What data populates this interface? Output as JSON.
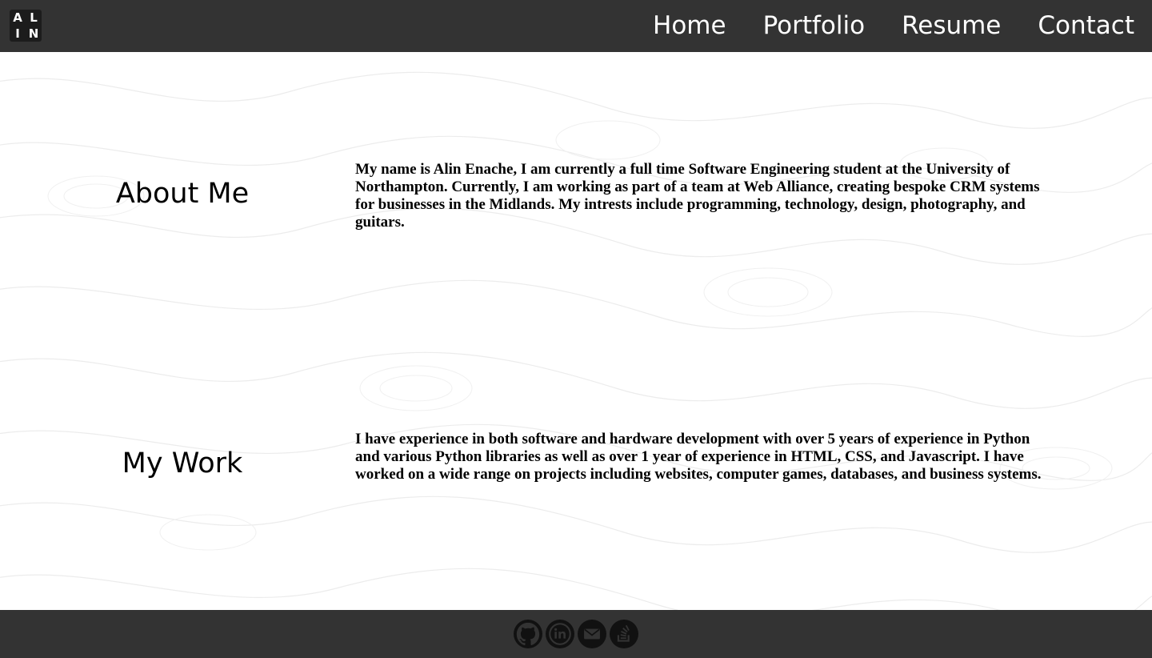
{
  "logo": {
    "letters": [
      "A",
      "L",
      "I",
      "N"
    ]
  },
  "nav": {
    "items": [
      {
        "label": "Home"
      },
      {
        "label": "Portfolio"
      },
      {
        "label": "Resume"
      },
      {
        "label": "Contact"
      }
    ]
  },
  "sections": [
    {
      "title": "About Me",
      "text": "My name is Alin Enache, I am currently a full time Software Engineering student at the University of Northampton. Currently, I am working as part of a team at Web Alliance, creating bespoke CRM systems for businesses in the Midlands. My intrests include programming, technology, design, photography, and guitars."
    },
    {
      "title": "My Work",
      "text": "I have experience in both software and hardware development with over 5 years of experience in Python and various Python libraries as well as over 1 year of experience in HTML, CSS, and Javascript. I have worked on a wide range on projects including websites, computer games, databases, and business systems."
    }
  ],
  "footer": {
    "icons": [
      "github-icon",
      "linkedin-icon",
      "email-icon",
      "stackoverflow-icon"
    ]
  },
  "colors": {
    "header_bg": "#333333",
    "footer_bg": "#333333",
    "text": "#000000",
    "nav_text": "#ffffff"
  }
}
